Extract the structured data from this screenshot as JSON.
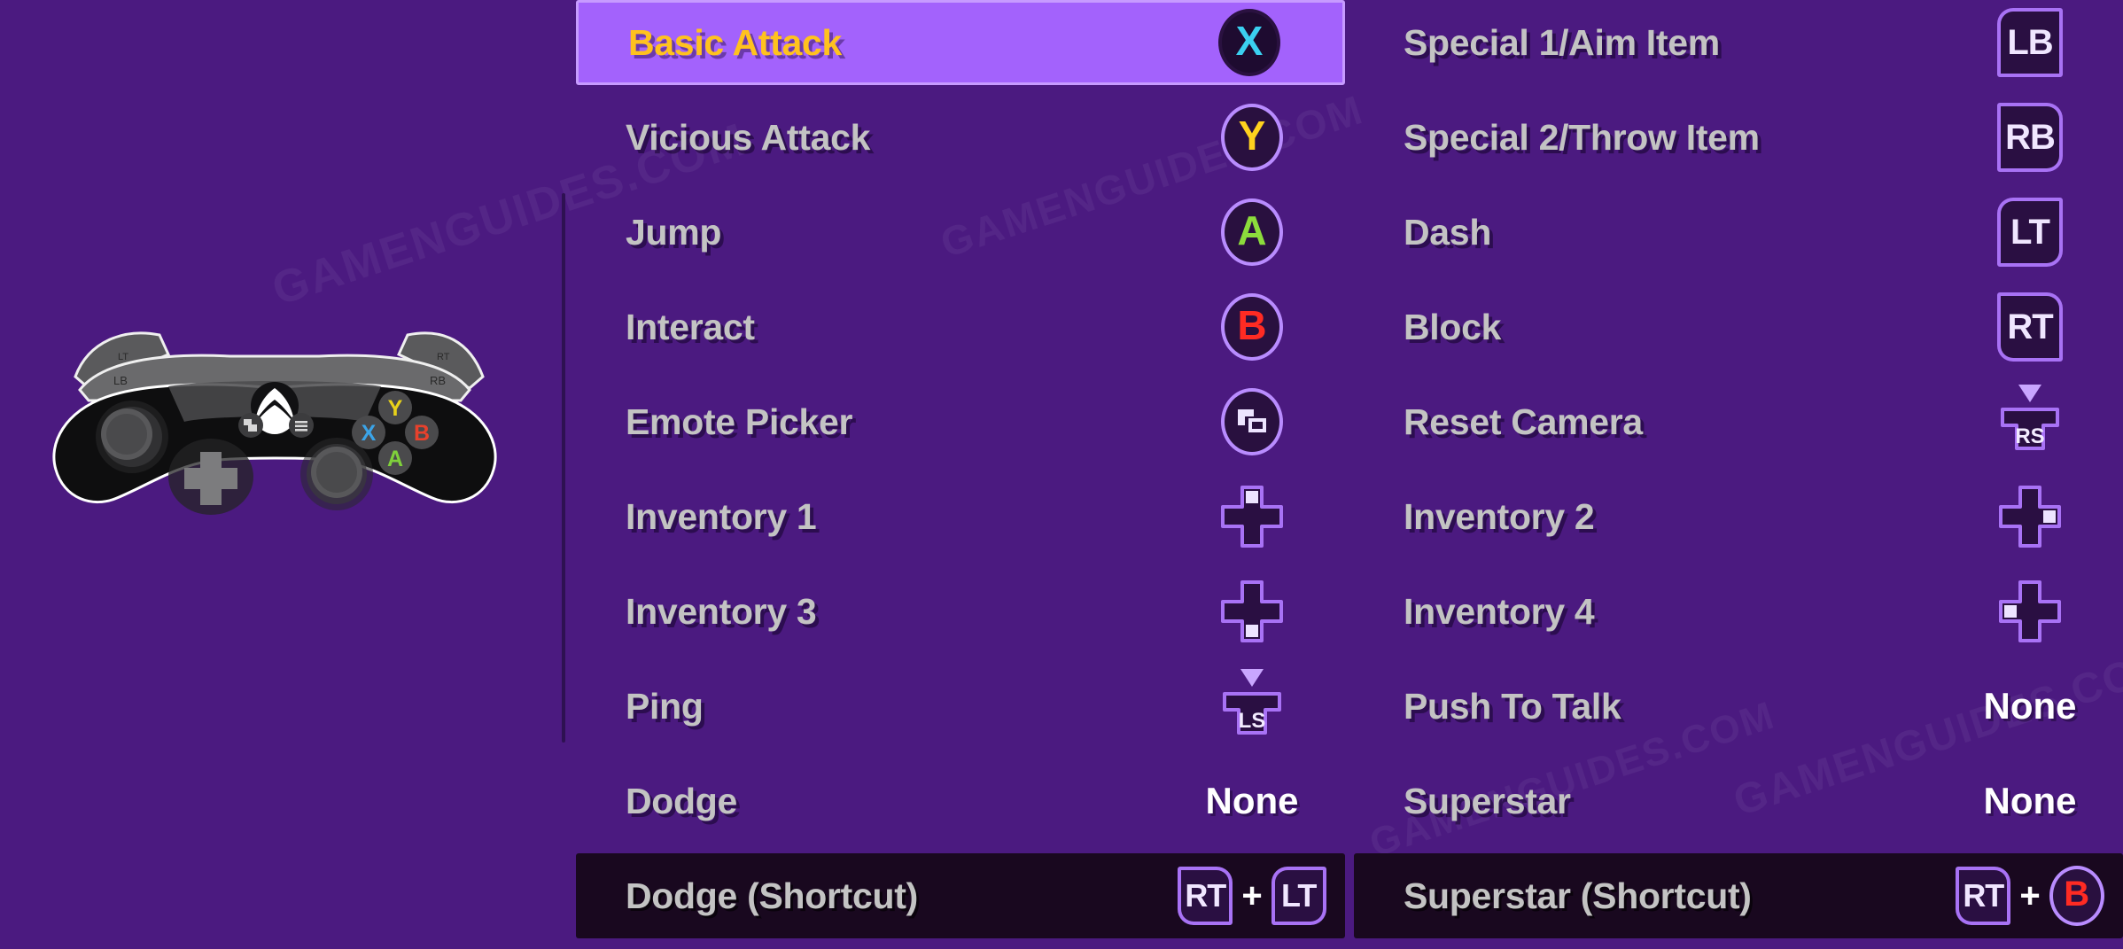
{
  "theme": {
    "background": "#4B1A80",
    "highlight_bg": "#A362FC",
    "highlight_text": "#FFC21E",
    "label_text": "#C3C3C3",
    "none_text": "#FFFFFF",
    "shortcut_bg": "#19081F",
    "key_border": "#A872F5",
    "key_fill": "#2A0F42"
  },
  "watermark": {
    "text": "GAMENGUIDES.COM"
  },
  "controller": {
    "name": "xbox-controller",
    "labels": {
      "lt": "LT",
      "lb": "LB",
      "rt": "RT",
      "rb": "RB"
    },
    "face_buttons": [
      {
        "name": "Y",
        "color": "#E8D21A"
      },
      {
        "name": "X",
        "color": "#3BA4E8"
      },
      {
        "name": "A",
        "color": "#7FD13B"
      },
      {
        "name": "B",
        "color": "#E8412C"
      }
    ]
  },
  "bindings": {
    "left_column": [
      {
        "label": "Basic Attack",
        "binding_type": "face",
        "binding": "X",
        "color": "#3BD0F0",
        "highlighted": true
      },
      {
        "label": "Vicious Attack",
        "binding_type": "face",
        "binding": "Y",
        "color": "#FFD21E",
        "highlighted": false
      },
      {
        "label": "Jump",
        "binding_type": "face",
        "binding": "A",
        "color": "#8CDB3C",
        "highlighted": false
      },
      {
        "label": "Interact",
        "binding_type": "face",
        "binding": "B",
        "color": "#FF2B23",
        "highlighted": false
      },
      {
        "label": "Emote Picker",
        "binding_type": "view",
        "binding": "View",
        "highlighted": false
      },
      {
        "label": "Inventory 1",
        "binding_type": "dpad",
        "binding": "D-Pad Up",
        "direction": "up",
        "highlighted": false
      },
      {
        "label": "Inventory 3",
        "binding_type": "dpad",
        "binding": "D-Pad Down",
        "direction": "down",
        "highlighted": false
      },
      {
        "label": "Ping",
        "binding_type": "stick",
        "binding": "LS",
        "highlighted": false
      },
      {
        "label": "Dodge",
        "binding_type": "text",
        "binding": "None",
        "highlighted": false
      },
      {
        "label": "Dodge (Shortcut)",
        "binding_type": "combo",
        "binding": "RT + LT",
        "combo": [
          {
            "kind": "trigger",
            "text": "RT",
            "shape": "rt"
          },
          {
            "kind": "trigger",
            "text": "LT",
            "shape": "lt"
          }
        ],
        "plus": "+",
        "shortcut": true,
        "highlighted": false
      }
    ],
    "right_column": [
      {
        "label": "Special 1/Aim Item",
        "binding_type": "bumper",
        "binding": "LB",
        "shape": "lb",
        "highlighted": false
      },
      {
        "label": "Special 2/Throw Item",
        "binding_type": "bumper",
        "binding": "RB",
        "shape": "rb",
        "highlighted": false
      },
      {
        "label": "Dash",
        "binding_type": "trigger",
        "binding": "LT",
        "shape": "lt",
        "highlighted": false
      },
      {
        "label": "Block",
        "binding_type": "trigger",
        "binding": "RT",
        "shape": "rt",
        "highlighted": false
      },
      {
        "label": "Reset Camera",
        "binding_type": "stick",
        "binding": "RS",
        "highlighted": false
      },
      {
        "label": "Inventory 2",
        "binding_type": "dpad",
        "binding": "D-Pad Right",
        "direction": "right",
        "highlighted": false
      },
      {
        "label": "Inventory 4",
        "binding_type": "dpad",
        "binding": "D-Pad Left",
        "direction": "left",
        "highlighted": false
      },
      {
        "label": "Push To Talk",
        "binding_type": "text",
        "binding": "None",
        "highlighted": false
      },
      {
        "label": "Superstar",
        "binding_type": "text",
        "binding": "None",
        "highlighted": false
      },
      {
        "label": "Superstar (Shortcut)",
        "binding_type": "combo",
        "binding": "RT + B",
        "combo": [
          {
            "kind": "trigger",
            "text": "RT",
            "shape": "rt"
          },
          {
            "kind": "face",
            "text": "B",
            "color": "#FF2B23"
          }
        ],
        "plus": "+",
        "shortcut": true,
        "highlighted": false
      }
    ]
  }
}
